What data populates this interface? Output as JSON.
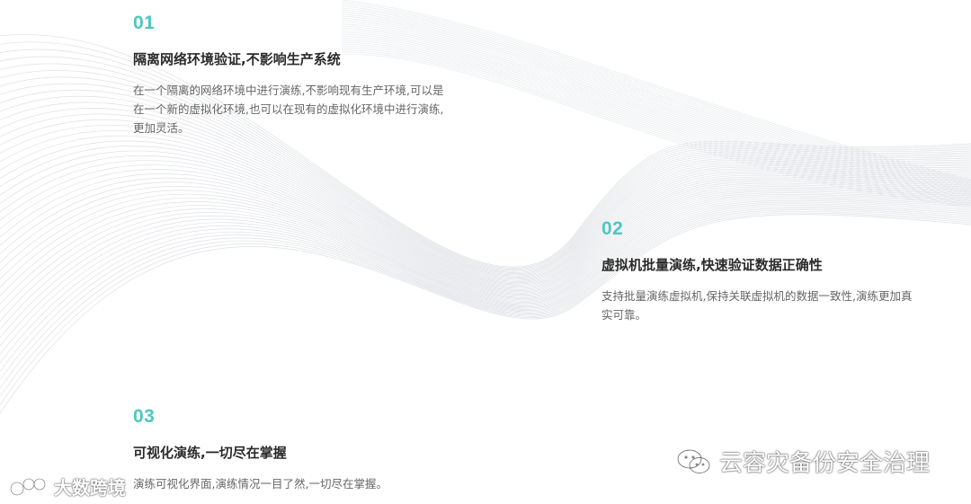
{
  "accent_color": "#4ec7c0",
  "items": [
    {
      "number": "01",
      "title": "隔离网络环境验证,不影响生产系统",
      "desc_lines": [
        "在一个隔离的网络环境中进行演练,不影响现有生产环境,可以是",
        "在一个新的虚拟化环境,也可以在现有的虚拟化环境中进行演练,",
        "更加灵活。"
      ]
    },
    {
      "number": "02",
      "title": "虚拟机批量演练,快速验证数据正确性",
      "desc_lines": [
        "支持批量演练虚拟机,保持关联虚拟机的数据一致性,演练更加真",
        "实可靠。"
      ]
    },
    {
      "number": "03",
      "title": "可视化演练,一切尽在掌握",
      "desc_lines": [
        "演练可视化界面,演练情况一目了然,一切尽在掌握。"
      ]
    }
  ],
  "watermarks": {
    "left_text": "大数跨境",
    "left_icon": "weibo-like-logo-icon",
    "right_text": "云容灾备份安全治理",
    "right_icon": "wechat-icon"
  }
}
